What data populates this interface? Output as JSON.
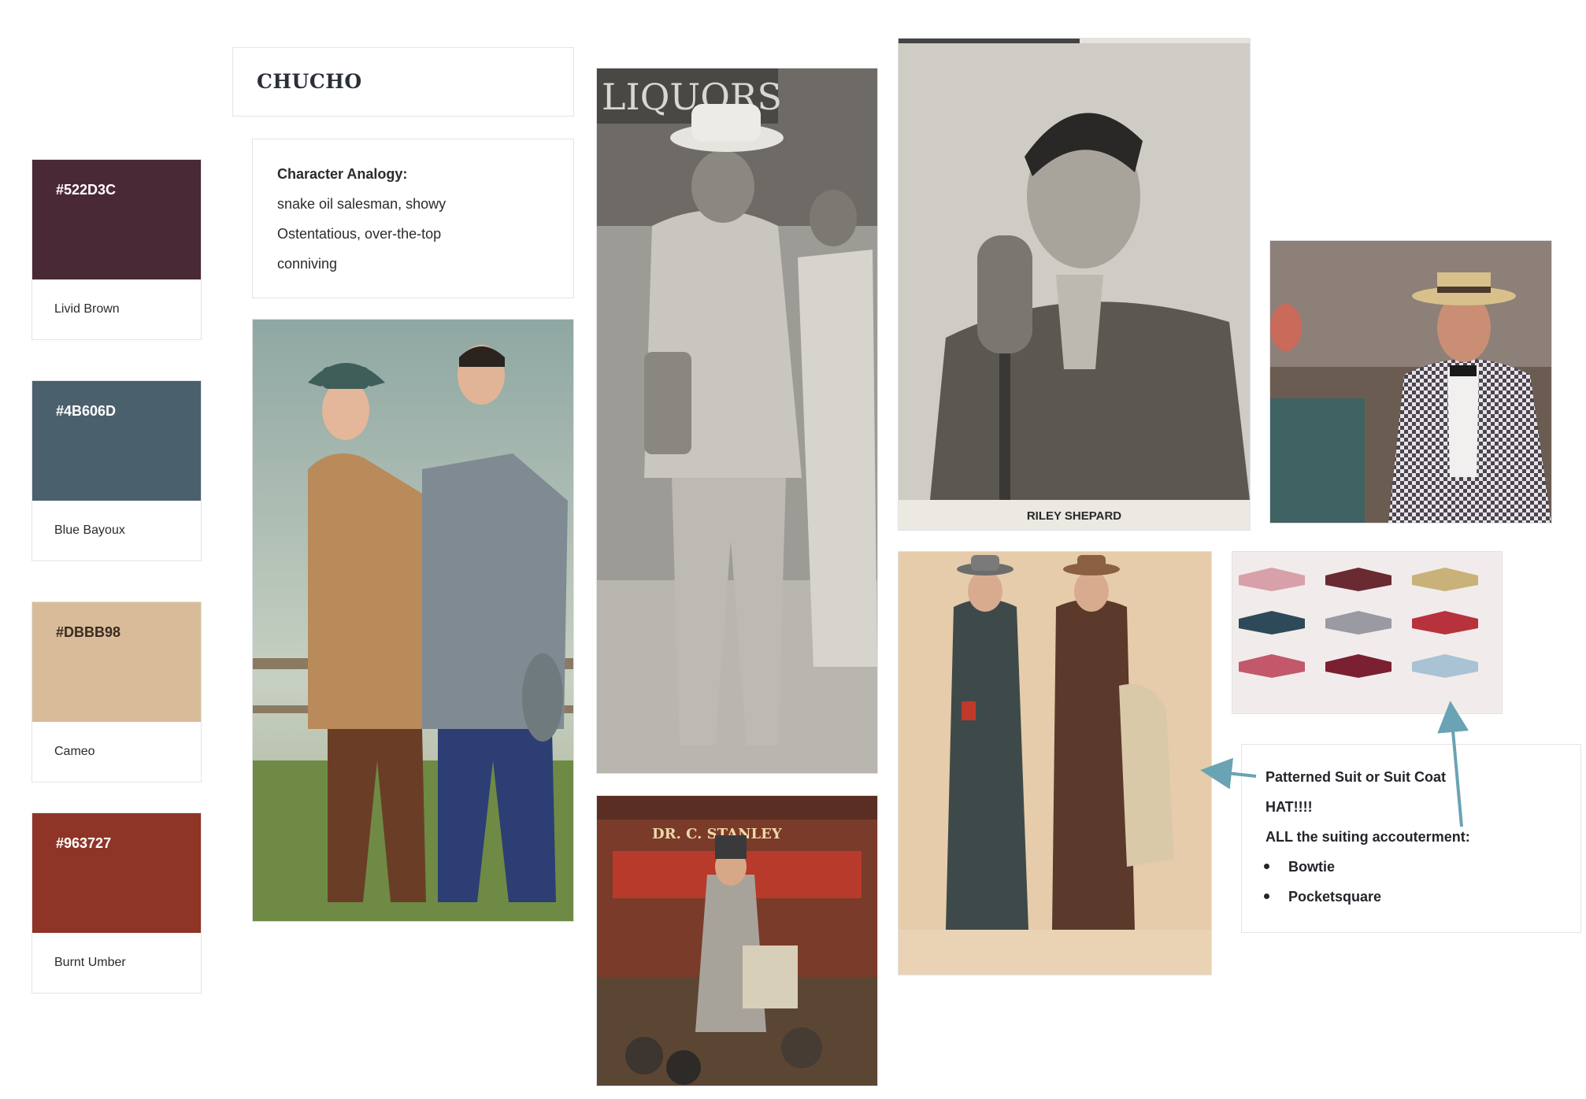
{
  "swatches": [
    {
      "hex": "#522D3C",
      "name": "Livid Brown",
      "color": "#4a2936"
    },
    {
      "hex": "#4B606D",
      "name": "Blue Bayoux",
      "color": "#4b606d"
    },
    {
      "hex": "#DBBB98",
      "name": "Cameo",
      "color": "#d8bb99"
    },
    {
      "hex": "#963727",
      "name": "Burnt Umber",
      "color": "#8e3527"
    }
  ],
  "board": {
    "title": "CHUCHO",
    "analogy": {
      "heading": "Character Analogy:",
      "lines": [
        "snake oil salesman, showy",
        "Ostentatious, over-the-top",
        "conniving"
      ]
    },
    "photos": {
      "riley_caption": "RILEY  SHEPARD",
      "storefront_sign": "LIQUORS",
      "medicine_show_sign": "DR. C. STANLEY"
    },
    "callout": {
      "line1": "Patterned Suit or Suit Coat",
      "line2": "HAT!!!!",
      "line3": "ALL the suiting accouterment:",
      "bullets": [
        "Bowtie",
        "Pocketsquare"
      ]
    },
    "arrow_color": "#6aa3b3"
  }
}
